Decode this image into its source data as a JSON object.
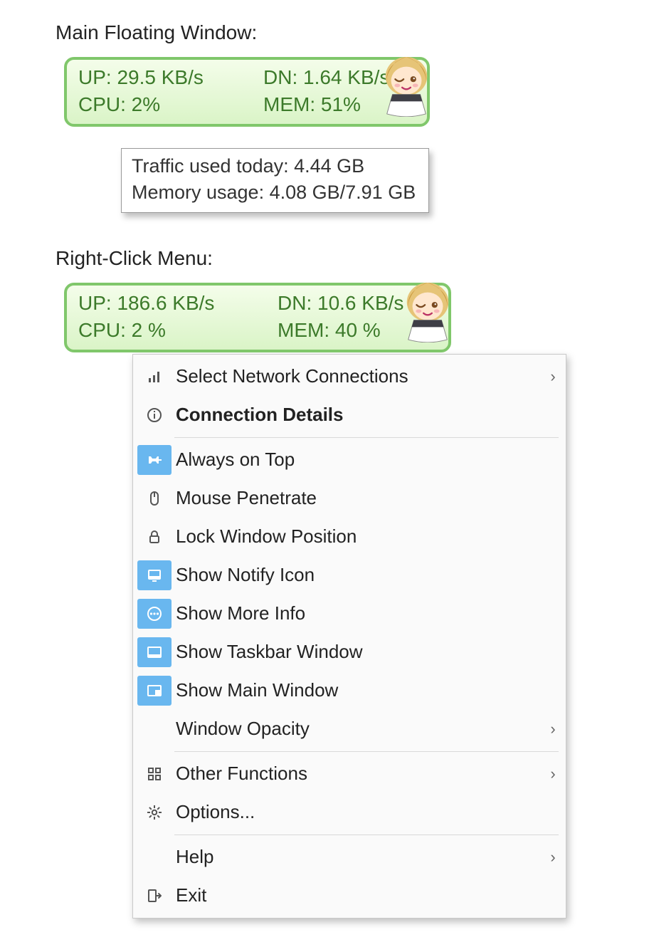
{
  "section1_title": "Main Floating Window:",
  "section2_title": "Right-Click Menu:",
  "widget1": {
    "up": "UP: 29.5 KB/s",
    "dn": "DN: 1.64 KB/s",
    "cpu": "CPU: 2%",
    "mem": "MEM: 51%"
  },
  "tooltip": {
    "line1": "Traffic used today: 4.44 GB",
    "line2": "Memory usage: 4.08 GB/7.91 GB"
  },
  "widget2": {
    "up": "UP: 186.6 KB/s",
    "dn": "DN: 10.6 KB/s",
    "cpu": "CPU: 2 %",
    "mem": "MEM: 40 %"
  },
  "menu": {
    "select_network": "Select Network Connections",
    "conn_details": "Connection Details",
    "always_on_top": "Always on Top",
    "mouse_penetrate": "Mouse Penetrate",
    "lock_pos": "Lock Window Position",
    "show_notify": "Show Notify Icon",
    "show_more": "Show More Info",
    "show_taskbar": "Show Taskbar Window",
    "show_main": "Show Main Window",
    "opacity": "Window Opacity",
    "other_fn": "Other Functions",
    "options": "Options...",
    "help": "Help",
    "exit": "Exit"
  },
  "menu_state": {
    "always_on_top": true,
    "mouse_penetrate": false,
    "lock_pos": false,
    "show_notify": true,
    "show_more": true,
    "show_taskbar": true,
    "show_main": true
  }
}
